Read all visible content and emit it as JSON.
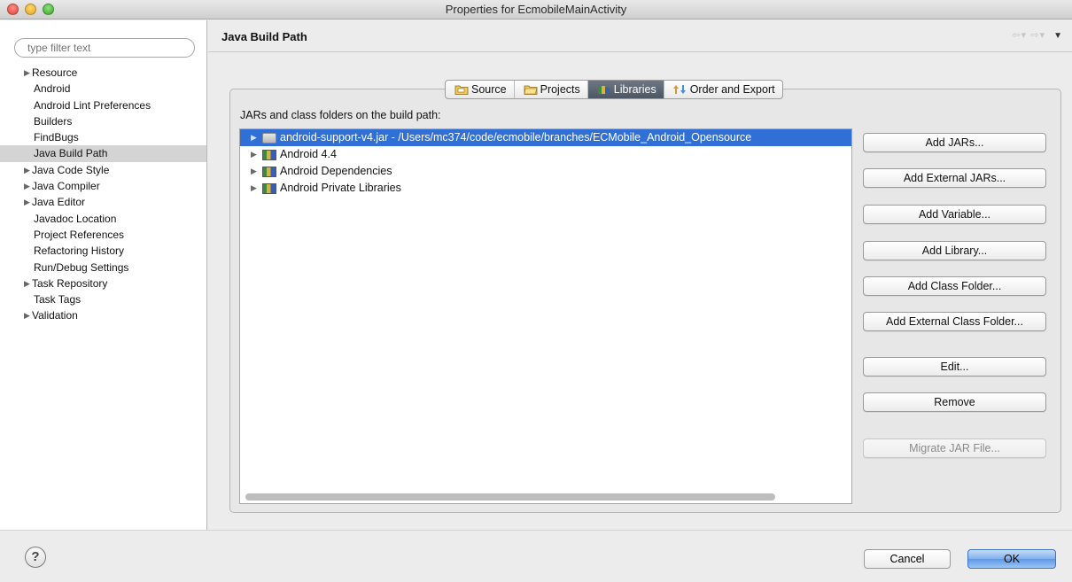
{
  "window": {
    "title": "Properties for EcmobileMainActivity"
  },
  "filter": {
    "placeholder": "type filter text"
  },
  "sidebar": {
    "items": [
      {
        "label": "Resource",
        "expandable": true
      },
      {
        "label": "Android",
        "expandable": false
      },
      {
        "label": "Android Lint Preferences",
        "expandable": false
      },
      {
        "label": "Builders",
        "expandable": false
      },
      {
        "label": "FindBugs",
        "expandable": false
      },
      {
        "label": "Java Build Path",
        "expandable": false,
        "selected": true
      },
      {
        "label": "Java Code Style",
        "expandable": true
      },
      {
        "label": "Java Compiler",
        "expandable": true
      },
      {
        "label": "Java Editor",
        "expandable": true
      },
      {
        "label": "Javadoc Location",
        "expandable": false
      },
      {
        "label": "Project References",
        "expandable": false
      },
      {
        "label": "Refactoring History",
        "expandable": false
      },
      {
        "label": "Run/Debug Settings",
        "expandable": false
      },
      {
        "label": "Task Repository",
        "expandable": true
      },
      {
        "label": "Task Tags",
        "expandable": false
      },
      {
        "label": "Validation",
        "expandable": true
      }
    ]
  },
  "page": {
    "title": "Java Build Path",
    "nav_icons": [
      "back-arrow-icon",
      "forward-arrow-icon",
      "view-menu-icon"
    ]
  },
  "tabs": [
    {
      "label": "Source",
      "icon": "source-folder-icon",
      "active": false
    },
    {
      "label": "Projects",
      "icon": "projects-folder-icon",
      "active": false
    },
    {
      "label": "Libraries",
      "icon": "libraries-icon",
      "active": true
    },
    {
      "label": "Order and Export",
      "icon": "order-export-icon",
      "active": false
    }
  ],
  "libraries": {
    "label": "JARs and class folders on the build path:",
    "rows": [
      {
        "label": "android-support-v4.jar - /Users/mc374/code/ecmobile/branches/ECMobile_Android_Opensource",
        "icon": "jar-icon",
        "selected": true
      },
      {
        "label": "Android 4.4",
        "icon": "library-icon",
        "selected": false
      },
      {
        "label": "Android Dependencies",
        "icon": "library-icon",
        "selected": false
      },
      {
        "label": "Android Private Libraries",
        "icon": "library-icon",
        "selected": false
      }
    ]
  },
  "buttons": {
    "add_jars": "Add JARs...",
    "add_external_jars": "Add External JARs...",
    "add_variable": "Add Variable...",
    "add_library": "Add Library...",
    "add_class_folder": "Add Class Folder...",
    "add_external_class_folder": "Add External Class Folder...",
    "edit": "Edit...",
    "remove": "Remove",
    "migrate_jar": "Migrate JAR File..."
  },
  "footer": {
    "help": "?",
    "cancel": "Cancel",
    "ok": "OK"
  }
}
